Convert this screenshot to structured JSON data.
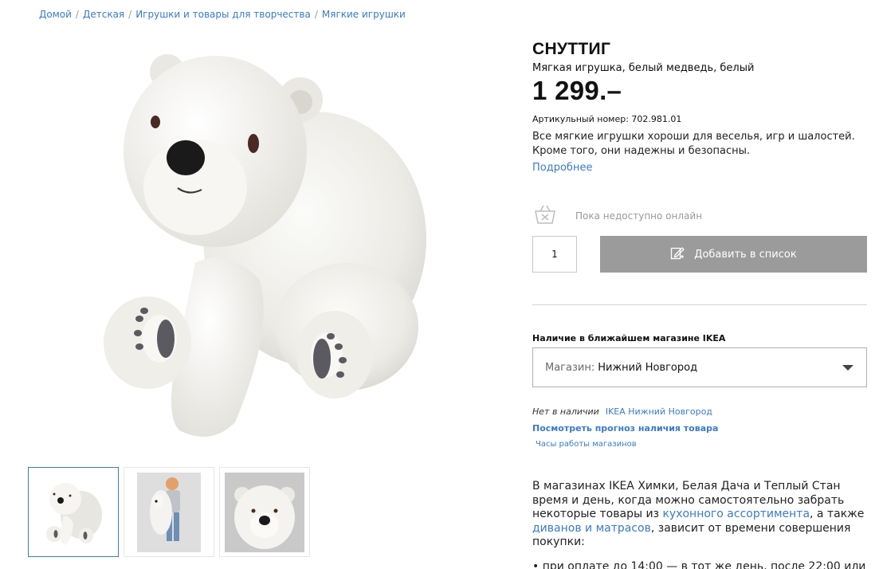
{
  "breadcrumb": [
    {
      "label": "Домой"
    },
    {
      "label": "Детская"
    },
    {
      "label": "Игрушки и товары для творчества"
    },
    {
      "label": "Мягкие игрушки"
    }
  ],
  "breadcrumb_separator": "/",
  "product": {
    "name": "СНУТТИГ",
    "subtitle": "Мягкая игрушка, белый медведь, белый",
    "price": "1 299.–",
    "article": "Артикульный номер: 702.981.01",
    "description": "Все мягкие игрушки хороши для веселья, игр и шалостей. Кроме того, они надежны и безопасны.",
    "more_link": "Подробнее"
  },
  "availability": {
    "online_status": "Пока недоступно онлайн",
    "online_icon": "basket-unavailable-icon"
  },
  "purchase": {
    "quantity": "1",
    "add_button": "Добавить в список",
    "add_icon": "add-to-list-icon"
  },
  "store": {
    "heading": "Наличие в ближайшем магазине IKEA",
    "select_label": "Магазин:",
    "select_value": "Нижний Новгород",
    "stock_status": "Нет в наличии",
    "stock_store": "IKEA Нижний Новгород",
    "forecast_link": "Посмотреть прогноз наличия товара",
    "hours_link": "Часы работы магазинов"
  },
  "info_text": {
    "part1": "В магазинах IKEA Химки, Белая Дача и Теплый Стан время и день, когда можно самостоятельно забрать некоторые товары из ",
    "link1": "кухонного ассортимента",
    "part2": ", а также ",
    "link2": "диванов и матрасов",
    "part3": ", зависит от времени совершения покупки:",
    "bullet1": "• при оплате до 14:00 — в тот же день, после 22:00 или"
  },
  "colors": {
    "link": "#3a7bc8",
    "button_disabled": "#9b9b9b"
  },
  "gallery": {
    "thumbnails": [
      "polar-bear-front",
      "child-with-bear",
      "bear-face-closeup"
    ],
    "active_index": 0
  }
}
